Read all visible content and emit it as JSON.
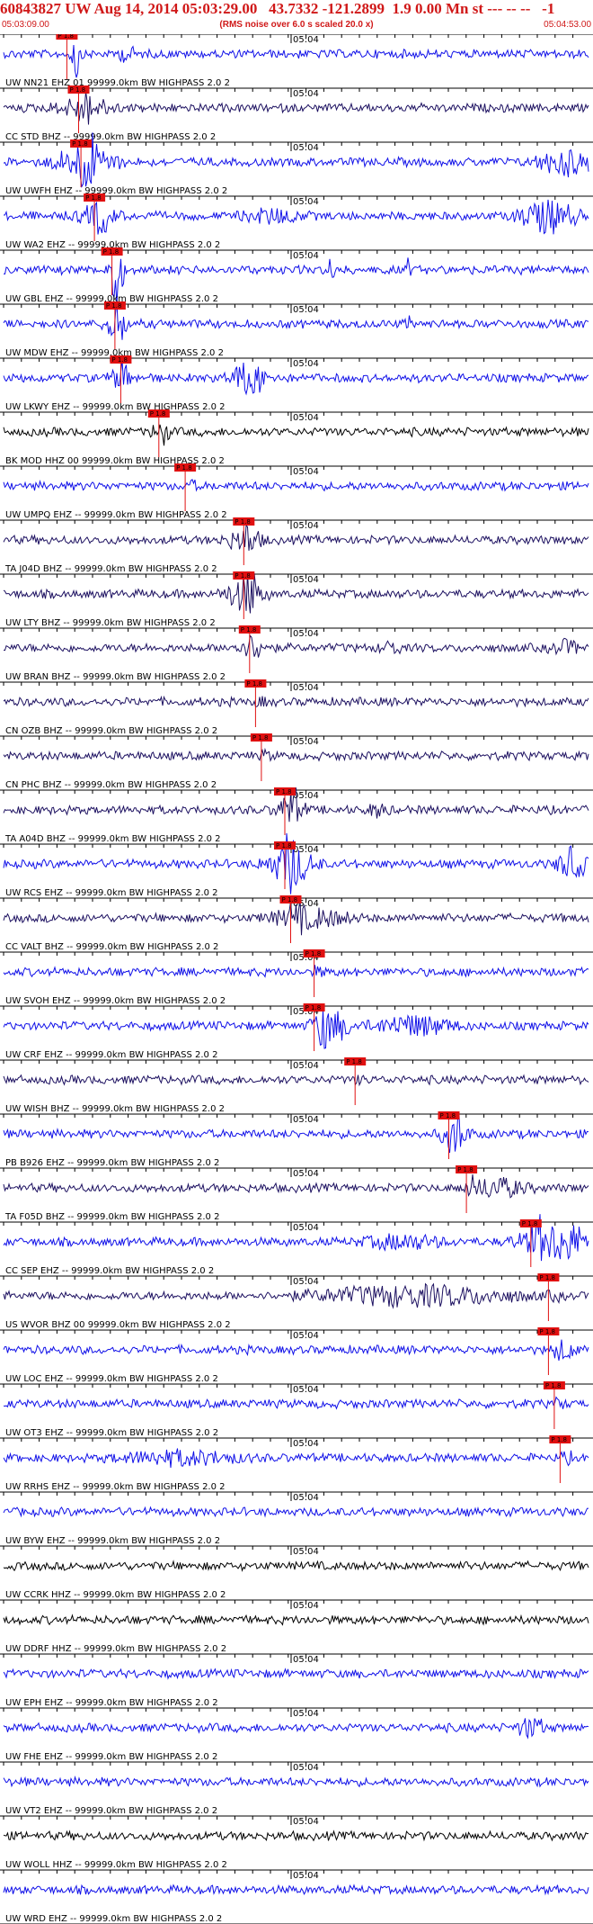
{
  "header": {
    "title": "60843827 UW Aug 14, 2014 05:03:29.00   43.7332 -121.2899  1.9 0.00 Mn st --- -- --   -1",
    "start_time": "05:03:09.00",
    "note": "(RMS noise over 6.0 s scaled 20.0 x)",
    "end_time": "05:04:53.00"
  },
  "colors": {
    "title": "#d01818",
    "trace_blue": "#1010e8",
    "trace_navy": "#1c1060",
    "trace_black": "#000000",
    "pick": "#e01010",
    "grid": "#000000"
  },
  "chart_data": {
    "type": "line",
    "title": "60843827 UW Aug 14, 2014 05:03:29.00   43.7332 -121.2899  1.9 0.00 Mn st --- -- --   -1",
    "x_range": [
      "05:03:09.00",
      "05:04:53.00"
    ],
    "x_tick_label": "05:04",
    "pick_label": "P 1.8",
    "traces": [
      {
        "name": "UW NN21 EHZ 01 99999.0km BW  HIGHPASS  2.0  2",
        "color": "blue",
        "pick": 0.108,
        "events": [
          [
            0.125,
            6,
            4
          ],
          [
            0.21,
            2,
            10
          ]
        ]
      },
      {
        "name": "CC STD BHZ -- 99999.0km BW  HIGHPASS  2.0  2",
        "color": "navy",
        "pick": 0.128,
        "events": [
          [
            0.14,
            3,
            30
          ]
        ]
      },
      {
        "name": "UW UWFH EHZ -- 99999.0km BW  HIGHPASS  2.0  2",
        "color": "blue",
        "pick": 0.132,
        "events": [
          [
            0.14,
            6,
            30
          ],
          [
            0.96,
            4,
            30
          ]
        ]
      },
      {
        "name": "UW WA2 EHZ -- 99999.0km BW  HIGHPASS  2.0  2",
        "color": "blue",
        "pick": 0.155,
        "events": [
          [
            0.16,
            3,
            20
          ],
          [
            0.46,
            2,
            30
          ],
          [
            0.93,
            5,
            30
          ]
        ]
      },
      {
        "name": "UW GBL EHZ -- 99999.0km BW  HIGHPASS  2.0  2",
        "color": "blue",
        "pick": 0.185,
        "events": [
          [
            0.19,
            7,
            8
          ],
          [
            0.56,
            5,
            3
          ],
          [
            0.69,
            3,
            3
          ]
        ]
      },
      {
        "name": "UW MDW EHZ -- 99999.0km BW  HIGHPASS  2.0  2",
        "color": "blue",
        "pick": 0.19,
        "events": [
          [
            0.19,
            5,
            10
          ],
          [
            0.69,
            2,
            3
          ]
        ]
      },
      {
        "name": "UW LKWY EHZ -- 99999.0km BW  HIGHPASS  2.0  2",
        "color": "blue",
        "pick": 0.2,
        "events": [
          [
            0.2,
            3,
            10
          ],
          [
            0.42,
            5,
            20
          ]
        ]
      },
      {
        "name": "BK MOD HHZ 00 99999.0km BW  HIGHPASS  2.0  2",
        "color": "black",
        "pick": 0.265,
        "events": [
          [
            0.265,
            2,
            10
          ]
        ]
      },
      {
        "name": "UW UMPQ EHZ -- 99999.0km BW  HIGHPASS  2.0  2",
        "color": "blue",
        "pick": 0.31,
        "events": []
      },
      {
        "name": "TA J04D BHZ -- 99999.0km BW  HIGHPASS  2.0  2",
        "color": "navy",
        "pick": 0.41,
        "events": [
          [
            0.41,
            3,
            20
          ]
        ]
      },
      {
        "name": "UW LTY BHZ -- 99999.0km BW  HIGHPASS  2.0  2",
        "color": "navy",
        "pick": 0.41,
        "events": [
          [
            0.41,
            5,
            20
          ]
        ]
      },
      {
        "name": "UW BRAN BHZ -- 99999.0km BW  HIGHPASS  2.0  2",
        "color": "navy",
        "pick": 0.42,
        "events": [
          [
            0.42,
            2,
            20
          ],
          [
            0.66,
            2,
            10
          ],
          [
            0.96,
            2,
            15
          ]
        ]
      },
      {
        "name": "CN OZB BHZ -- 99999.0km BW  HIGHPASS  2.0  2",
        "color": "navy",
        "pick": 0.43,
        "events": []
      },
      {
        "name": "CN PHC BHZ -- 99999.0km BW  HIGHPASS  2.0  2",
        "color": "navy",
        "pick": 0.44,
        "events": []
      },
      {
        "name": "TA A04D BHZ -- 99999.0km BW  HIGHPASS  2.0  2",
        "color": "navy",
        "pick": 0.48,
        "events": [
          [
            0.49,
            4,
            15
          ],
          [
            0.64,
            2,
            10
          ]
        ]
      },
      {
        "name": "UW RCS EHZ -- 99999.0km BW  HIGHPASS  2.0  2",
        "color": "blue",
        "pick": 0.48,
        "events": [
          [
            0.49,
            6,
            25
          ],
          [
            0.97,
            5,
            15
          ]
        ]
      },
      {
        "name": "CC VALT BHZ -- 99999.0km BW  HIGHPASS  2.0  2",
        "color": "navy",
        "pick": 0.49,
        "events": [
          [
            0.52,
            3,
            40
          ]
        ]
      },
      {
        "name": "UW SVOH EHZ -- 99999.0km BW  HIGHPASS  2.0  2",
        "color": "blue",
        "pick": 0.53,
        "events": []
      },
      {
        "name": "UW CRF EHZ -- 99999.0km BW  HIGHPASS  2.0  2",
        "color": "blue",
        "pick": 0.53,
        "events": [
          [
            0.56,
            5,
            20
          ],
          [
            0.7,
            3,
            40
          ]
        ]
      },
      {
        "name": "UW WISH BHZ -- 99999.0km BW  HIGHPASS  2.0  2",
        "color": "navy",
        "pick": 0.6,
        "events": []
      },
      {
        "name": "PB B926 EHZ -- 99999.0km BW  HIGHPASS  2.0  2",
        "color": "blue",
        "pick": 0.76,
        "events": [
          [
            0.77,
            4,
            15
          ]
        ]
      },
      {
        "name": "TA F05D BHZ -- 99999.0km BW  HIGHPASS  2.0  2",
        "color": "navy",
        "pick": 0.79,
        "events": [
          [
            0.84,
            3,
            30
          ]
        ]
      },
      {
        "name": "CC SEP EHZ -- 99999.0km BW  HIGHPASS  2.0  2",
        "color": "blue",
        "pick": 0.9,
        "events": [
          [
            0.95,
            6,
            40
          ],
          [
            0.68,
            2,
            40
          ]
        ]
      },
      {
        "name": "US WVOR BHZ 00 99999.0km BW  HIGHPASS  2.0  2",
        "color": "navy",
        "pick": 0.93,
        "events": [
          [
            0.7,
            3,
            100
          ]
        ]
      },
      {
        "name": "UW LOC EHZ -- 99999.0km BW  HIGHPASS  2.0  2",
        "color": "blue",
        "pick": 0.93,
        "events": [
          [
            0.96,
            3,
            10
          ]
        ]
      },
      {
        "name": "UW OT3 EHZ -- 99999.0km BW  HIGHPASS  2.0  2",
        "color": "blue",
        "pick": 0.94,
        "events": []
      },
      {
        "name": "UW RRHS EHZ -- 99999.0km BW  HIGHPASS  2.0  2",
        "color": "blue",
        "pick": 0.95,
        "events": [
          [
            0.3,
            2,
            60
          ]
        ]
      },
      {
        "name": "UW BYW EHZ -- 99999.0km BW  HIGHPASS  2.0  2",
        "color": "blue",
        "pick": null,
        "events": []
      },
      {
        "name": "UW CCRK HHZ -- 99999.0km BW  HIGHPASS  2.0  2",
        "color": "black",
        "pick": null,
        "events": []
      },
      {
        "name": "UW DDRF HHZ -- 99999.0km BW  HIGHPASS  2.0  2",
        "color": "black",
        "pick": null,
        "events": []
      },
      {
        "name": "UW EPH EHZ -- 99999.0km BW  HIGHPASS  2.0  2",
        "color": "blue",
        "pick": null,
        "events": []
      },
      {
        "name": "UW FHE EHZ -- 99999.0km BW  HIGHPASS  2.0  2",
        "color": "blue",
        "pick": null,
        "events": [
          [
            0.9,
            3,
            15
          ]
        ]
      },
      {
        "name": "UW VT2 EHZ -- 99999.0km BW  HIGHPASS  2.0  2",
        "color": "blue",
        "pick": null,
        "events": []
      },
      {
        "name": "UW WOLL HHZ -- 99999.0km BW  HIGHPASS  2.0  2",
        "color": "black",
        "pick": null,
        "events": []
      },
      {
        "name": "UW WRD EHZ -- 99999.0km BW  HIGHPASS  2.0  2",
        "color": "blue",
        "pick": null,
        "events": []
      }
    ]
  }
}
